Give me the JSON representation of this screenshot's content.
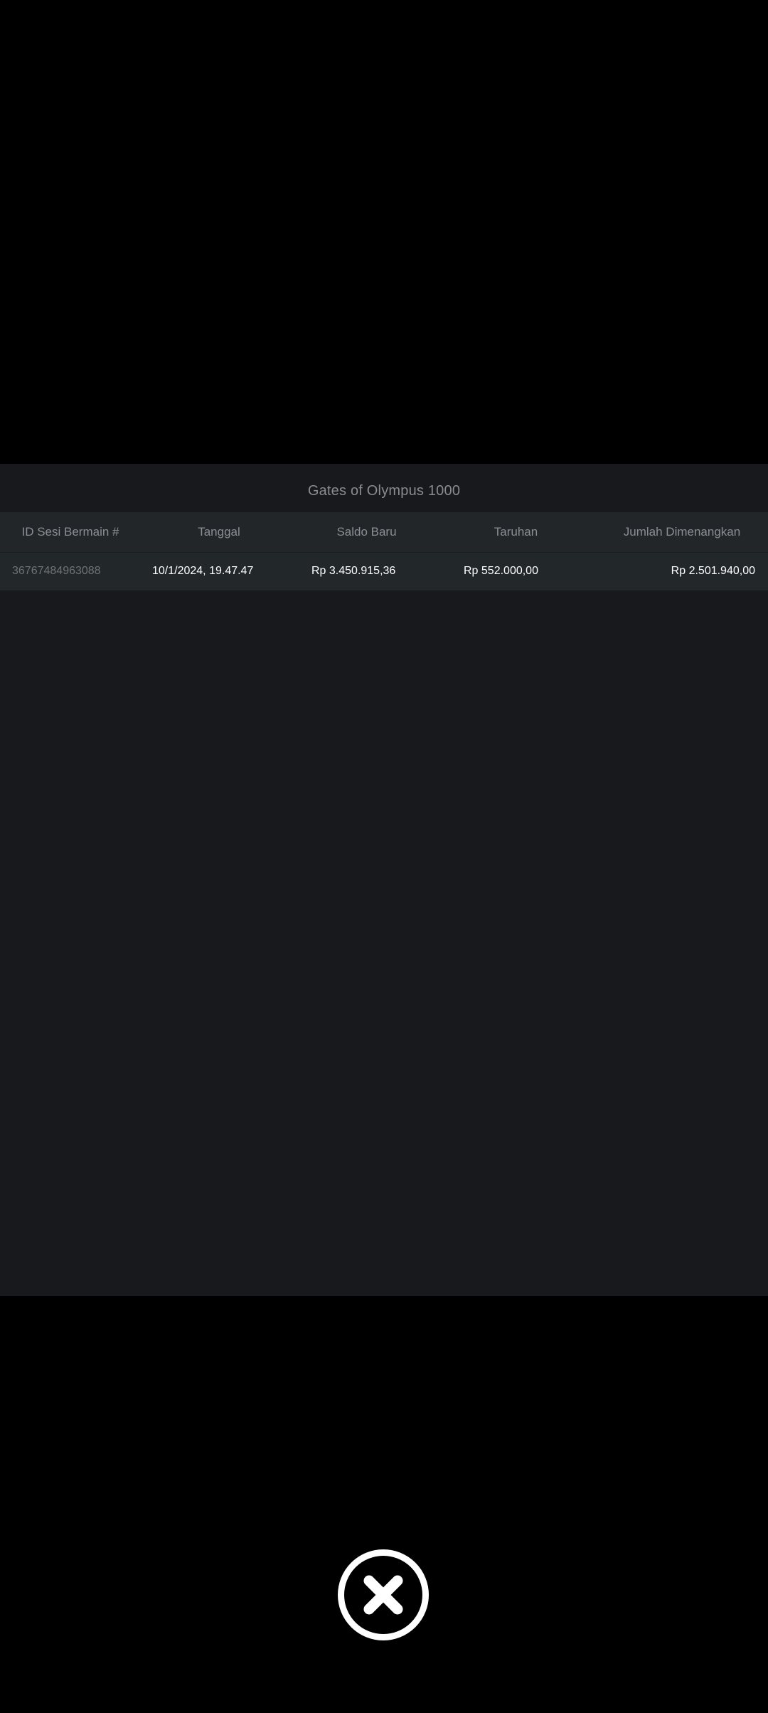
{
  "panel": {
    "title": "Gates of Olympus 1000"
  },
  "table": {
    "columns": [
      "ID Sesi Bermain #",
      "Tanggal",
      "Saldo Baru",
      "Taruhan",
      "Jumlah Dimenangkan"
    ],
    "rows": [
      {
        "id": "36767484963088",
        "date": "10/1/2024, 19.47.47",
        "new_balance": "Rp 3.450.915,36",
        "bet": "Rp 552.000,00",
        "win": "Rp 2.501.940,00"
      }
    ]
  },
  "close": {
    "icon": "close-icon"
  },
  "colors": {
    "background": "#000000",
    "panel": "#18191c",
    "header_row": "#222629",
    "data_row": "#22272a",
    "muted_text": "#8b8e92",
    "value_text": "#ffffff"
  }
}
